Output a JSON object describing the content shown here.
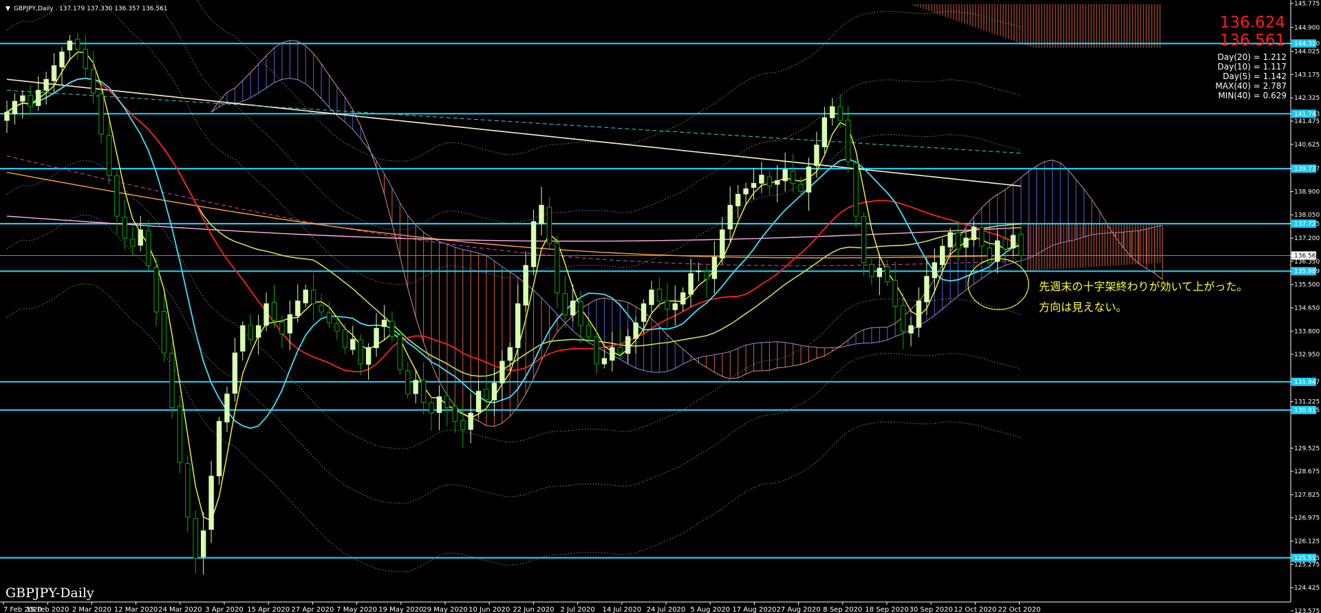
{
  "header": {
    "symbol": "GBPJPY,Daily",
    "ohlc": "137.179 137.330 136.357 136.561"
  },
  "watermark": "GBPJPY-Daily",
  "big_prices": [
    "136.624",
    "136.561"
  ],
  "stats": [
    "Day(20) = 1.212",
    "Day(10) = 1.117",
    "Day(5) = 1.142",
    "MAX(40) = 2.787",
    "MIN(40) = 0.629"
  ],
  "annotation": {
    "line1": "先週末の十字架終わりが効いて上がった。",
    "line2": "方向は見えない。",
    "color": "#ffff33"
  },
  "colors": {
    "background": "#000000",
    "hline": "#1ec8f0",
    "bull_candle": "#d8ffb0",
    "bear_candle": "#00b000",
    "ma_red": "#ff2020",
    "ma_yellow": "#ffff33",
    "ma_cyan": "#40e0ff",
    "ma_khaki": "#c8e05a",
    "ma_orange": "#ffa040",
    "ma_pink": "#ffb0e8",
    "ma_cream": "#fff0c8",
    "kumo_bull": "#5a60d8",
    "kumo_bear": "#d86040"
  },
  "chart_data": {
    "type": "candlestick",
    "symbol": "GBPJPY",
    "timeframe": "Daily",
    "ylim": [
      123.9,
      145.9
    ],
    "y_ticks": [
      "145.775",
      "144.900",
      "144.310",
      "144.025",
      "143.175",
      "142.325",
      "141.743",
      "141.475",
      "140.625",
      "139.737",
      "138.900",
      "138.050",
      "137.725",
      "137.200",
      "136.561",
      "136.350",
      "135.989",
      "135.500",
      "134.650",
      "133.800",
      "132.950",
      "131.947",
      "131.225",
      "130.915",
      "129.525",
      "128.675",
      "127.825",
      "126.975",
      "126.125",
      "125.515",
      "125.275",
      "124.425",
      "123.575"
    ],
    "highlighted_levels": [
      144.31,
      141.743,
      139.737,
      137.725,
      135.989,
      131.947,
      130.915,
      125.515
    ],
    "current_price": 136.561,
    "x_labels": [
      "7 Feb 2020",
      "19 Feb 2020",
      "2 Mar 2020",
      "12 Mar 2020",
      "24 Mar 2020",
      "3 Apr 2020",
      "15 Apr 2020",
      "27 Apr 2020",
      "7 May 2020",
      "19 May 2020",
      "29 May 2020",
      "10 Jun 2020",
      "22 Jun 2020",
      "2 Jul 2020",
      "14 Jul 2020",
      "24 Jul 2020",
      "5 Aug 2020",
      "17 Aug 2020",
      "27 Aug 2020",
      "8 Sep 2020",
      "18 Sep 2020",
      "30 Sep 2020",
      "12 Oct 2020",
      "22 Oct 2020"
    ],
    "candles_close_approx": [
      141.8,
      142.2,
      142.4,
      142.0,
      142.6,
      143.0,
      143.5,
      144.0,
      144.4,
      144.1,
      143.4,
      142.5,
      141.0,
      139.5,
      138.0,
      137.2,
      136.9,
      137.5,
      136.2,
      134.5,
      133.0,
      131.0,
      129.0,
      127.0,
      125.5,
      126.5,
      128.5,
      130.5,
      131.5,
      133.0,
      134.0,
      133.5,
      134.0,
      134.8,
      134.2,
      133.7,
      134.4,
      134.9,
      135.3,
      134.8,
      134.5,
      134.1,
      133.8,
      133.2,
      133.5,
      132.6,
      133.2,
      133.9,
      134.2,
      133.6,
      132.4,
      131.5,
      132.0,
      131.2,
      130.8,
      131.4,
      131.0,
      130.5,
      130.2,
      130.8,
      131.6,
      131.3,
      131.9,
      132.7,
      133.2,
      134.8,
      136.2,
      137.8,
      138.4,
      137.0,
      135.2,
      134.4,
      134.9,
      134.0,
      133.6,
      132.6,
      132.8,
      133.2,
      133.0,
      133.6,
      134.1,
      134.8,
      135.3,
      134.9,
      134.6,
      134.8,
      135.2,
      135.9,
      136.0,
      135.7,
      136.5,
      137.5,
      138.4,
      138.8,
      139.0,
      139.2,
      139.5,
      139.1,
      139.3,
      139.7,
      139.2,
      138.9,
      139.8,
      140.6,
      141.6,
      142.0,
      141.5,
      140.0,
      138.0,
      136.3,
      135.8,
      136.1,
      135.6,
      134.7,
      133.8,
      134.0,
      134.9,
      135.8,
      136.3,
      136.9,
      137.4,
      136.8,
      137.2,
      137.6,
      136.9,
      136.3,
      137.1,
      136.8,
      137.3,
      136.56
    ],
    "moving_averages": [
      {
        "color": "red",
        "start": 140.6,
        "end": 137.8
      },
      {
        "color": "yellow",
        "start": 142.5,
        "end": 136.6
      },
      {
        "color": "cyan",
        "start": 143.0,
        "end": 136.2
      }
    ]
  }
}
